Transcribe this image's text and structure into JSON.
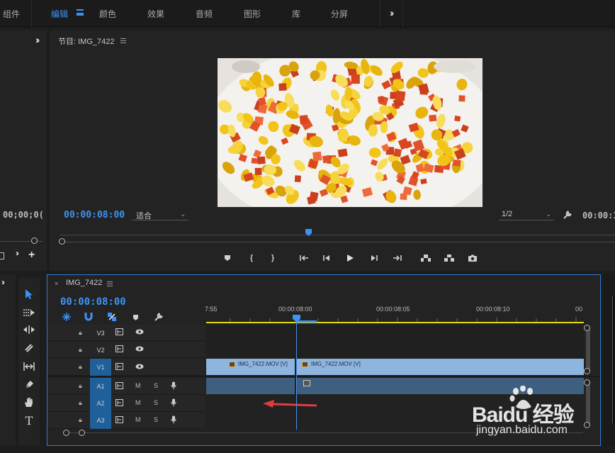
{
  "workspace_tabs": [
    {
      "label": "组件"
    },
    {
      "label": "编辑"
    },
    {
      "label": "颜色"
    },
    {
      "label": "效果"
    },
    {
      "label": "音频"
    },
    {
      "label": "图形"
    },
    {
      "label": "库"
    },
    {
      "label": "分屏"
    }
  ],
  "active_workspace": "编辑",
  "colors": {
    "accent": "#3d93f5",
    "selected_track": "#1f5f9a",
    "video_clip": "#8eb5e0",
    "audio_clip": "#3f5f80",
    "work_area": "#e5d90c",
    "arrow": "#e23b3b"
  },
  "left_panel": {
    "timecode": "00;00;0("
  },
  "program_monitor": {
    "title": "节目: IMG_7422",
    "timecode": "00:00:08:00",
    "fit": "适合",
    "resolution": "1/2",
    "duration": "00:00:1"
  },
  "transport_icons": [
    "marker-icon",
    "in-point-icon",
    "out-point-icon",
    "go-to-in-icon",
    "step-back-icon",
    "play-icon",
    "step-forward-icon",
    "go-to-out-icon",
    "lift-icon",
    "extract-icon",
    "export-frame-icon"
  ],
  "tools": [
    "selection-tool-icon",
    "track-select-tool-icon",
    "ripple-edit-tool-icon",
    "razor-tool-icon",
    "slip-tool-icon",
    "pen-tool-icon",
    "hand-tool-icon",
    "type-tool-icon"
  ],
  "timeline": {
    "sequence_name": "IMG_7422",
    "timecode": "00:00:08:00",
    "ruler": [
      "7:55",
      "00:00:08:00",
      "00:00:08:05",
      "00:00:08:10",
      "00"
    ],
    "video_tracks": [
      {
        "name": "V3",
        "targeted": false
      },
      {
        "name": "V2",
        "targeted": false
      },
      {
        "name": "V1",
        "targeted": true
      }
    ],
    "audio_tracks": [
      {
        "name": "A1",
        "targeted": true
      },
      {
        "name": "A2",
        "targeted": true
      },
      {
        "name": "A3",
        "targeted": true
      }
    ],
    "track_mute": "M",
    "track_solo": "S",
    "clips": [
      {
        "label": "IMG_7422.MOV [V]"
      },
      {
        "label": "IMG_7422.MOV [V]"
      }
    ]
  },
  "watermark": {
    "brand": "Baidu 经验",
    "url": "jingyan.baidu.com"
  }
}
